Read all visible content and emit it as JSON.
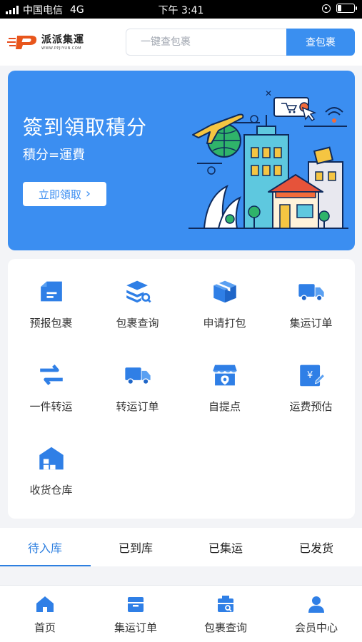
{
  "status_bar": {
    "carrier": "中国电信",
    "network": "4G",
    "time": "下午 3:41"
  },
  "header": {
    "logo_name": "派派集運",
    "logo_url": "WWW.PPJIYUN.COM",
    "search_placeholder": "一键查包裹",
    "search_button": "查包裹"
  },
  "banner": {
    "title": "簽到領取積分",
    "subtitle": "積分=運費",
    "button_label": "立即領取",
    "button_chevron": "›"
  },
  "menu": {
    "items": [
      {
        "label": "预报包裹",
        "icon": "parcel-forecast-icon"
      },
      {
        "label": "包裹查询",
        "icon": "parcel-search-icon"
      },
      {
        "label": "申请打包",
        "icon": "box-icon"
      },
      {
        "label": "集运订单",
        "icon": "truck-icon"
      },
      {
        "label": "一件转运",
        "icon": "transfer-arrows-icon"
      },
      {
        "label": "转运订单",
        "icon": "truck-icon"
      },
      {
        "label": "自提点",
        "icon": "store-pin-icon"
      },
      {
        "label": "运费预估",
        "icon": "fee-estimate-icon"
      },
      {
        "label": "收货仓库",
        "icon": "warehouse-icon"
      }
    ]
  },
  "order_tabs": {
    "items": [
      "待入库",
      "已到库",
      "已集运",
      "已发货"
    ],
    "active": 0
  },
  "bottom_nav": {
    "items": [
      {
        "label": "首页",
        "icon": "home-icon"
      },
      {
        "label": "集运订单",
        "icon": "order-box-icon"
      },
      {
        "label": "包裹查询",
        "icon": "parcel-search-icon"
      },
      {
        "label": "会员中心",
        "icon": "user-icon"
      }
    ]
  },
  "colors": {
    "primary": "#3b8ef1",
    "active_tab": "#2d7fe0",
    "icon_blue": "#2f7fe6"
  }
}
